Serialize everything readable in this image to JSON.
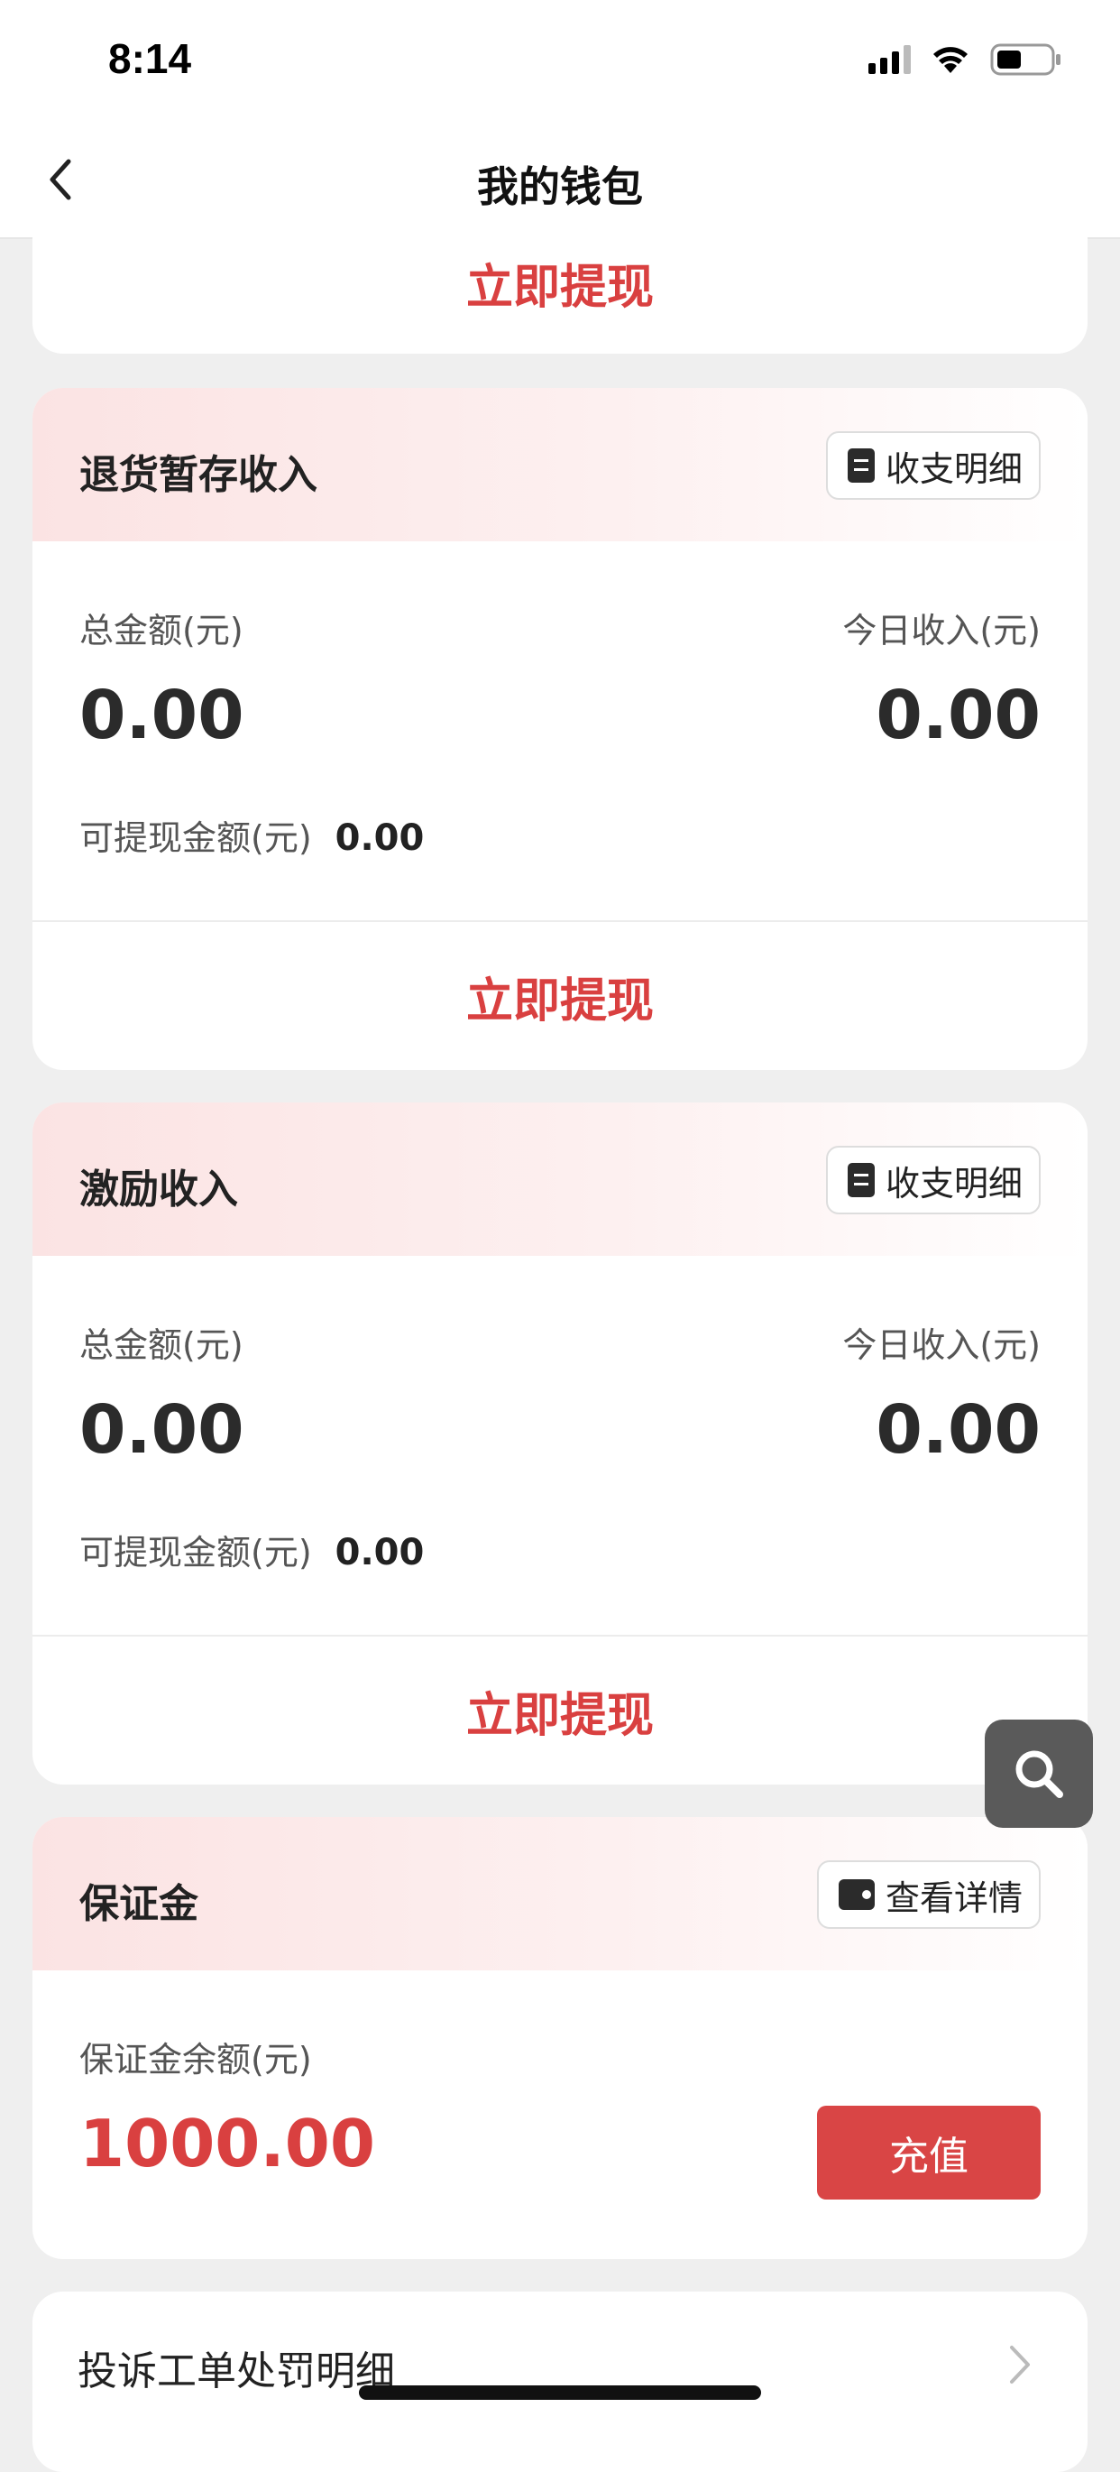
{
  "status": {
    "time": "8:14"
  },
  "nav": {
    "title": "我的钱包"
  },
  "top_card": {
    "withdraw_label": "立即提现"
  },
  "return_income": {
    "title": "退货暂存收入",
    "detail_label": "收支明细",
    "total_label": "总金额(元)",
    "total_value": "0.00",
    "today_label": "今日收入(元)",
    "today_value": "0.00",
    "withdrawable_label": "可提现金额(元)",
    "withdrawable_value": "0.00",
    "withdraw_label": "立即提现"
  },
  "incentive_income": {
    "title": "激励收入",
    "detail_label": "收支明细",
    "total_label": "总金额(元)",
    "total_value": "0.00",
    "today_label": "今日收入(元)",
    "today_value": "0.00",
    "withdrawable_label": "可提现金额(元)",
    "withdrawable_value": "0.00",
    "withdraw_label": "立即提现"
  },
  "deposit": {
    "title": "保证金",
    "detail_label": "查看详情",
    "balance_label": "保证金余额(元)",
    "balance_value": "1000.00",
    "recharge_label": "充值"
  },
  "complaint_row": {
    "label": "投诉工单处罚明细"
  },
  "icons": {
    "back": "chevron-left-icon",
    "detail": "document-icon",
    "deposit_detail": "wallet-icon",
    "row_arrow": "chevron-right-icon",
    "floating": "search-icon"
  },
  "colors": {
    "accent": "#d94040",
    "header_tint": "#fbe3e3"
  }
}
